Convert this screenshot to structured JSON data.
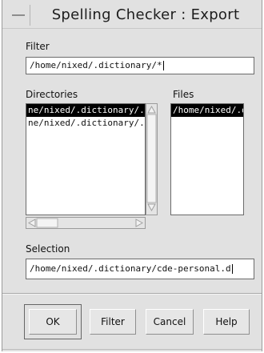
{
  "window": {
    "title": "Spelling Checker : Export"
  },
  "filter": {
    "label": "Filter",
    "value": "/home/nixed/.dictionary/*"
  },
  "directories": {
    "label": "Directories",
    "items": [
      {
        "label": "ne/nixed/.dictionary/.",
        "selected": true
      },
      {
        "label": "ne/nixed/.dictionary/..",
        "selected": false
      }
    ]
  },
  "files": {
    "label": "Files",
    "items": [
      {
        "label": "/home/nixed/.d",
        "selected": true
      }
    ]
  },
  "selection": {
    "label": "Selection",
    "value": "/home/nixed/.dictionary/cde-personal.d"
  },
  "buttons": {
    "ok": "OK",
    "filter": "Filter",
    "cancel": "Cancel",
    "help": "Help"
  }
}
